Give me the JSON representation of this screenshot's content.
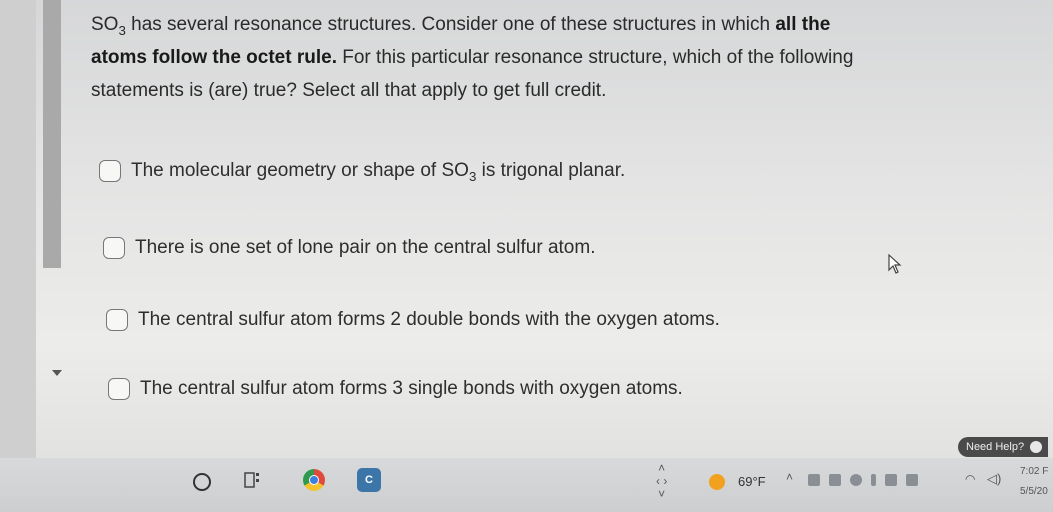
{
  "question": {
    "part1": "SO",
    "part1_sub": "3",
    "part2": " has several resonance structures. Consider one of these structures in which ",
    "bold": "all the atoms follow the octet rule.",
    "part3": " For this particular resonance structure, which of the following statements is (are) true? Select all that apply to get full credit."
  },
  "options": [
    {
      "pre": "The molecular geometry or shape of SO",
      "sub": "3",
      "post": " is trigonal planar."
    },
    {
      "text": "There is one set of lone pair on the central sulfur atom."
    },
    {
      "text": "The central sulfur atom forms 2 double bonds with the oxygen atoms."
    },
    {
      "text": "The central sulfur atom forms 3 single bonds with oxygen atoms."
    }
  ],
  "help": {
    "label": "Need Help?"
  },
  "taskbar": {
    "app_icon": "C",
    "temperature": "69°F",
    "time": "7:02 F",
    "date": "5/5/20"
  },
  "icons": [
    "checkbox",
    "mouse-cursor-icon",
    "start-icon",
    "task-view-icon",
    "chrome-icon",
    "app-icon",
    "weather-icon",
    "wifi-icon",
    "volume-icon"
  ]
}
